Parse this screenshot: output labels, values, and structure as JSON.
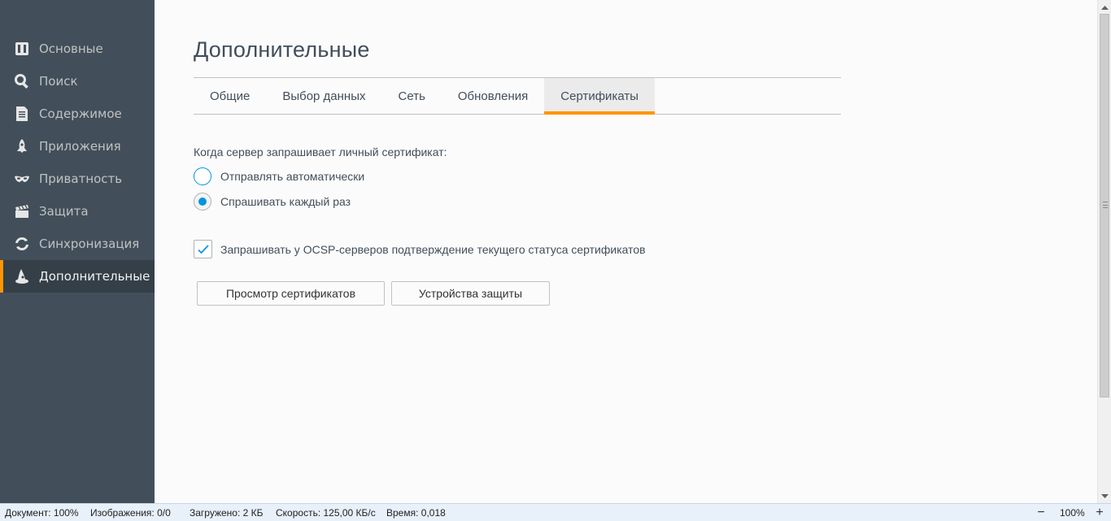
{
  "sidebar": {
    "items": [
      {
        "label": "Основные",
        "icon": "general-icon"
      },
      {
        "label": "Поиск",
        "icon": "search-icon"
      },
      {
        "label": "Содержимое",
        "icon": "document-icon"
      },
      {
        "label": "Приложения",
        "icon": "rocket-icon"
      },
      {
        "label": "Приватность",
        "icon": "mask-icon"
      },
      {
        "label": "Защита",
        "icon": "clapper-icon"
      },
      {
        "label": "Синхронизация",
        "icon": "sync-icon"
      },
      {
        "label": "Дополнительные",
        "icon": "wizard-hat-icon",
        "selected": true
      }
    ]
  },
  "main": {
    "title": "Дополнительные",
    "tabs": [
      {
        "label": "Общие"
      },
      {
        "label": "Выбор данных"
      },
      {
        "label": "Сеть"
      },
      {
        "label": "Обновления"
      },
      {
        "label": "Сертификаты",
        "selected": true
      }
    ],
    "cert_request_label": "Когда сервер запрашивает личный сертификат:",
    "radio_auto": "Отправлять автоматически",
    "radio_ask": "Спрашивать каждый раз",
    "ocsp_label": "Запрашивать у OCSP-серверов подтверждение текущего статуса сертификатов",
    "ocsp_checked": true,
    "view_certs_button": "Просмотр сертификатов",
    "security_devices_button": "Устройства защиты"
  },
  "statusbar": {
    "document": "Документ: 100%",
    "images": "Изображения: 0/0",
    "loaded": "Загружено: 2 КБ",
    "speed": "Скорость: 125,00 КБ/с",
    "time": "Время: 0,018",
    "zoom_minus": "−",
    "zoom_value": "100%",
    "zoom_plus": "+"
  },
  "colors": {
    "sidebar_bg": "#424f5a",
    "accent": "#ff9500",
    "radio_blue": "#0095dd"
  }
}
